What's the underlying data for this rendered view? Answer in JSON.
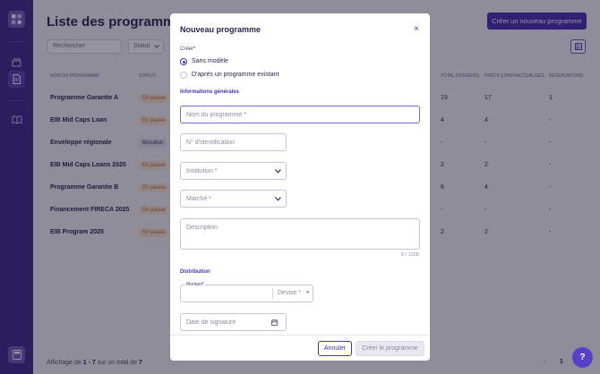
{
  "sidebar": {
    "icons": [
      "app-logo-icon",
      "folder-icon",
      "document-icon",
      "book-icon",
      "calculator-icon"
    ]
  },
  "page": {
    "title": "Liste des programmes",
    "create_button": "Créer un nouveau programme",
    "search_placeholder": "Rechercher",
    "status_filter": "Statut",
    "columns": [
      "Nom du programme",
      "Statut",
      "Total dossiers",
      "Prêts contractualisés",
      "Réservations"
    ],
    "rows": [
      {
        "name": "Programme Garantie A",
        "status": "En pause",
        "dossiers": "19",
        "prets": "17",
        "reservations": "1"
      },
      {
        "name": "EIB Mid Caps Loan",
        "status": "En pause",
        "dossiers": "4",
        "prets": "4",
        "reservations": "-"
      },
      {
        "name": "Enveloppe régionale",
        "status": "Brouillon",
        "dossiers": "-",
        "prets": "-",
        "reservations": "-"
      },
      {
        "name": "EIB Mid Caps Loans 2025",
        "status": "En pause",
        "dossiers": "2",
        "prets": "2",
        "reservations": "-"
      },
      {
        "name": "Programme Garantie B",
        "status": "En pause",
        "dossiers": "6",
        "prets": "4",
        "reservations": "-"
      },
      {
        "name": "Financement FIRECA 2025",
        "status": "En pause",
        "dossiers": "-",
        "prets": "-",
        "reservations": "-"
      },
      {
        "name": "EIB Program 2025",
        "status": "En pause",
        "dossiers": "2",
        "prets": "2",
        "reservations": "-"
      }
    ],
    "footer_prefix": "Affichage de",
    "footer_range": "1 - 7",
    "footer_mid": "sur un total de",
    "footer_total": "7",
    "pager_prev": "‹",
    "pager_page": "1",
    "pager_next": "›"
  },
  "modal": {
    "title": "Nouveau programme",
    "close": "×",
    "create_label": "Créer*",
    "radio_options": [
      {
        "label": "Sans modèle",
        "checked": true
      },
      {
        "label": "D'après un programme existant",
        "checked": false
      }
    ],
    "section_general": "Informations générales",
    "name_placeholder": "Nom du programme *",
    "id_placeholder": "N° d'identification",
    "institution_placeholder": "Institution *",
    "market_placeholder": "Marché *",
    "description_placeholder": "Description",
    "description_counter": "0 / 1200",
    "section_distribution": "Distribution",
    "amount_label": "Montant*",
    "currency_placeholder": "Devise *",
    "signature_placeholder": "Date de signature",
    "cancel_button": "Annuler",
    "submit_button": "Créer le programme"
  },
  "help_button": "?"
}
